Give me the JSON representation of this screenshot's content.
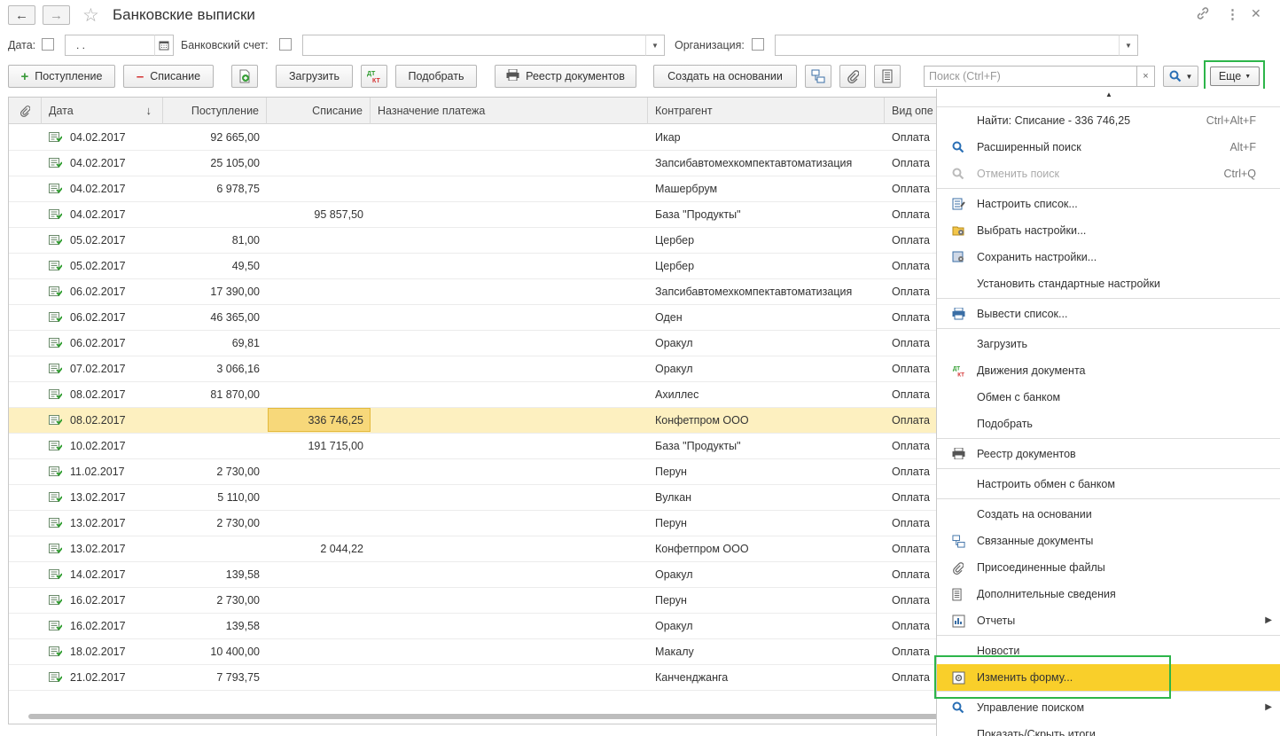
{
  "window": {
    "title": "Банковские выписки"
  },
  "filters": {
    "date_label": "Дата:",
    "date_value": " .  .",
    "account_label": "Банковский счет:",
    "org_label": "Организация:"
  },
  "toolbar": {
    "incoming": "Поступление",
    "outgoing": "Списание",
    "load": "Загрузить",
    "dtkt": "ДТ КТ",
    "match": "Подобрать",
    "registry": "Реестр документов",
    "create_based": "Создать на основании",
    "search_placeholder": "Поиск (Ctrl+F)",
    "more": "Еще"
  },
  "table": {
    "headers": [
      "Дата",
      "Поступление",
      "Списание",
      "Назначение платежа",
      "Контрагент",
      "Вид опе"
    ],
    "rows": [
      {
        "date": "04.02.2017",
        "in": "92 665,00",
        "out": "",
        "purpose": "",
        "contractor": "Икар",
        "kind": "Оплата"
      },
      {
        "date": "04.02.2017",
        "in": "25 105,00",
        "out": "",
        "purpose": "",
        "contractor": "Запсибавтомехкомпектавтоматизация",
        "kind": "Оплата"
      },
      {
        "date": "04.02.2017",
        "in": "6 978,75",
        "out": "",
        "purpose": "",
        "contractor": "Машербрум",
        "kind": "Оплата"
      },
      {
        "date": "04.02.2017",
        "in": "",
        "out": "95 857,50",
        "purpose": "",
        "contractor": "База \"Продукты\"",
        "kind": "Оплата"
      },
      {
        "date": "05.02.2017",
        "in": "81,00",
        "out": "",
        "purpose": "",
        "contractor": "Цербер",
        "kind": "Оплата"
      },
      {
        "date": "05.02.2017",
        "in": "49,50",
        "out": "",
        "purpose": "",
        "contractor": "Цербер",
        "kind": "Оплата"
      },
      {
        "date": "06.02.2017",
        "in": "17 390,00",
        "out": "",
        "purpose": "",
        "contractor": "Запсибавтомехкомпектавтоматизация",
        "kind": "Оплата"
      },
      {
        "date": "06.02.2017",
        "in": "46 365,00",
        "out": "",
        "purpose": "",
        "contractor": "Оден",
        "kind": "Оплата"
      },
      {
        "date": "06.02.2017",
        "in": "69,81",
        "out": "",
        "purpose": "",
        "contractor": "Оракул",
        "kind": "Оплата"
      },
      {
        "date": "07.02.2017",
        "in": "3 066,16",
        "out": "",
        "purpose": "",
        "contractor": "Оракул",
        "kind": "Оплата"
      },
      {
        "date": "08.02.2017",
        "in": "81 870,00",
        "out": "",
        "purpose": "",
        "contractor": "Ахиллес",
        "kind": "Оплата"
      },
      {
        "date": "08.02.2017",
        "in": "",
        "out": "336 746,25",
        "purpose": "",
        "contractor": "Конфетпром ООО",
        "kind": "Оплата"
      },
      {
        "date": "10.02.2017",
        "in": "",
        "out": "191 715,00",
        "purpose": "",
        "contractor": "База \"Продукты\"",
        "kind": "Оплата"
      },
      {
        "date": "11.02.2017",
        "in": "2 730,00",
        "out": "",
        "purpose": "",
        "contractor": "Перун",
        "kind": "Оплата"
      },
      {
        "date": "13.02.2017",
        "in": "5 110,00",
        "out": "",
        "purpose": "",
        "contractor": "Вулкан",
        "kind": "Оплата"
      },
      {
        "date": "13.02.2017",
        "in": "2 730,00",
        "out": "",
        "purpose": "",
        "contractor": "Перун",
        "kind": "Оплата"
      },
      {
        "date": "13.02.2017",
        "in": "",
        "out": "2 044,22",
        "purpose": "",
        "contractor": "Конфетпром ООО",
        "kind": "Оплата"
      },
      {
        "date": "14.02.2017",
        "in": "139,58",
        "out": "",
        "purpose": "",
        "contractor": "Оракул",
        "kind": "Оплата"
      },
      {
        "date": "16.02.2017",
        "in": "2 730,00",
        "out": "",
        "purpose": "",
        "contractor": "Перун",
        "kind": "Оплата"
      },
      {
        "date": "16.02.2017",
        "in": "139,58",
        "out": "",
        "purpose": "",
        "contractor": "Оракул",
        "kind": "Оплата"
      },
      {
        "date": "18.02.2017",
        "in": "10 400,00",
        "out": "",
        "purpose": "",
        "contractor": "Макалу",
        "kind": "Оплата"
      },
      {
        "date": "21.02.2017",
        "in": "7 793,75",
        "out": "",
        "purpose": "",
        "contractor": "Канченджанга",
        "kind": "Оплата"
      }
    ]
  },
  "menu": {
    "items": [
      {
        "label": "Найти: Списание - 336 746,25",
        "shortcut": "Ctrl+Alt+F",
        "icon": "none"
      },
      {
        "label": "Расширенный поиск",
        "shortcut": "Alt+F",
        "icon": "search-icon"
      },
      {
        "label": "Отменить поиск",
        "shortcut": "Ctrl+Q",
        "icon": "cancel-search-icon",
        "disabled": true
      },
      {
        "label": "Настроить список...",
        "icon": "list-settings-icon"
      },
      {
        "label": "Выбрать настройки...",
        "icon": "folder-settings-icon"
      },
      {
        "label": "Сохранить настройки...",
        "icon": "save-settings-icon"
      },
      {
        "label": "Установить стандартные настройки",
        "icon": "none"
      },
      {
        "label": "Вывести список...",
        "icon": "print-list-icon"
      },
      {
        "label": "Загрузить",
        "icon": "none"
      },
      {
        "label": "Движения документа",
        "icon": "dtkt-icon"
      },
      {
        "label": "Обмен с банком",
        "icon": "none"
      },
      {
        "label": "Подобрать",
        "icon": "none"
      },
      {
        "label": "Реестр документов",
        "icon": "printer-icon"
      },
      {
        "label": "Настроить обмен с банком",
        "icon": "none"
      },
      {
        "label": "Создать на основании",
        "icon": "none"
      },
      {
        "label": "Связанные документы",
        "icon": "related-docs-icon"
      },
      {
        "label": "Присоединенные файлы",
        "icon": "paperclip-icon"
      },
      {
        "label": "Дополнительные сведения",
        "icon": "info-icon"
      },
      {
        "label": "Отчеты",
        "icon": "reports-icon",
        "submenu": true
      },
      {
        "label": "Новости",
        "icon": "none"
      },
      {
        "label": "Изменить форму...",
        "icon": "form-icon",
        "active": true
      },
      {
        "label": "Управление поиском",
        "icon": "search-icon",
        "submenu": true
      },
      {
        "label": "Показать/Скрыть итоги",
        "icon": "none"
      }
    ]
  },
  "colors": {
    "selected_row": "#fdf0c0",
    "selected_cell": "#f7d87a",
    "menu_active": "#f9cf2a",
    "highlight_box": "#2db54a"
  }
}
